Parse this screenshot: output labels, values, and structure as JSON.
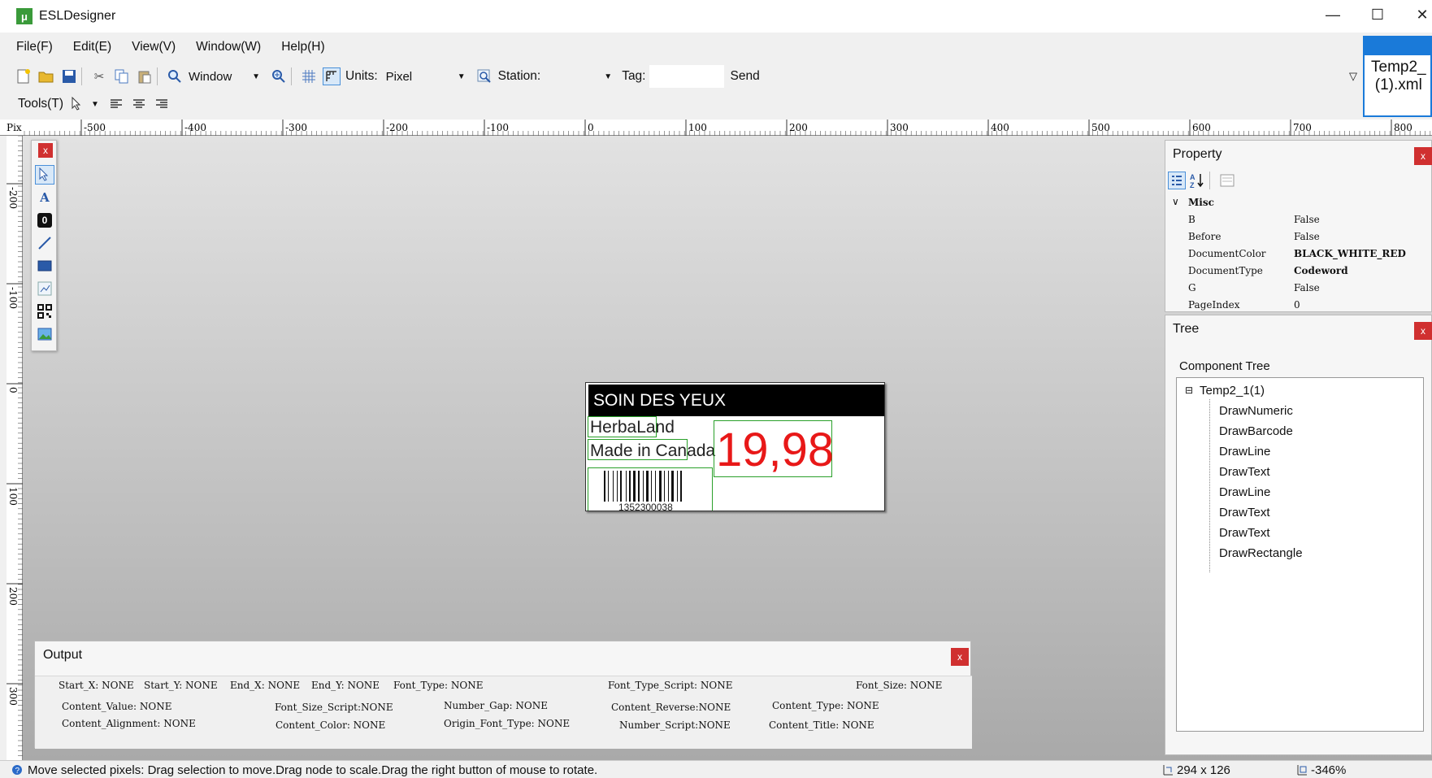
{
  "window": {
    "title": "ESLDesigner",
    "app_icon": "μ",
    "minimize": "—",
    "maximize": "☐",
    "close": "✕"
  },
  "menu": [
    "File(F)",
    "Edit(E)",
    "View(V)",
    "Window(W)",
    "Help(H)"
  ],
  "toolbar": {
    "window_label": "Window",
    "units_label": "Units:",
    "units_value": "Pixel",
    "station_label": "Station:",
    "station_value": "",
    "tag_label": "Tag:",
    "tag_value": "",
    "send_label": "Send",
    "tools_label": "Tools(T)"
  },
  "ruler": {
    "unit_label": "Pix",
    "top_labels": [
      "-500",
      "-400",
      "-300",
      "-200",
      "-100",
      "0",
      "100",
      "200",
      "300",
      "400",
      "500",
      "600",
      "700",
      "800"
    ],
    "left_labels": [
      "-200",
      "-100",
      "0",
      "100",
      "200",
      "300"
    ]
  },
  "palette": {
    "close": "x",
    "tools": [
      "select-tool",
      "text-tool",
      "numeric-tool",
      "line-tool",
      "rectangle-tool",
      "chart-tool",
      "qrcode-tool",
      "image-tool"
    ]
  },
  "label": {
    "header": "SOIN DES YEUX",
    "line1": "HerbaLand",
    "line2": "Made in Canada",
    "price": "19,98",
    "barcode_number": "1352300038"
  },
  "output": {
    "title": "Output",
    "close": "x",
    "fields": [
      "Start_X: NONE",
      "Start_Y: NONE",
      "End_X: NONE",
      "End_Y: NONE",
      "Font_Type:  NONE",
      "Font_Type_Script:  NONE",
      "Font_Size:  NONE",
      "Content_Value: NONE",
      "Font_Size_Script:NONE",
      "Number_Gap:  NONE",
      "Content_Reverse:NONE",
      "Content_Type: NONE",
      "Content_Alignment: NONE",
      "Content_Color: NONE",
      "Origin_Font_Type: NONE",
      "Number_Script:NONE",
      "Content_Title: NONE"
    ]
  },
  "property": {
    "title": "Property",
    "close": "x",
    "category": "Misc",
    "rows": [
      {
        "name": "B",
        "value": "False"
      },
      {
        "name": "Before",
        "value": "False"
      },
      {
        "name": "DocumentColor",
        "value": "BLACK_WHITE_RED"
      },
      {
        "name": "DocumentType",
        "value": "Codeword"
      },
      {
        "name": "G",
        "value": "False"
      },
      {
        "name": "PageIndex",
        "value": "0"
      }
    ]
  },
  "tree": {
    "title": "Tree",
    "close": "x",
    "group_label": "Component Tree",
    "expander": "⊟",
    "root": "Temp2_1(1)",
    "children": [
      "DrawNumeric",
      "DrawBarcode",
      "DrawLine",
      "DrawText",
      "DrawLine",
      "DrawText",
      "DrawText",
      "DrawRectangle"
    ]
  },
  "right_tab": {
    "line1": "Temp2_",
    "line2": "(1).xml"
  },
  "status": {
    "message": "Move selected pixels: Drag selection to move.Drag node to scale.Drag the right button of mouse to rotate.",
    "size": "294 x 126",
    "zoom": "-346%"
  }
}
